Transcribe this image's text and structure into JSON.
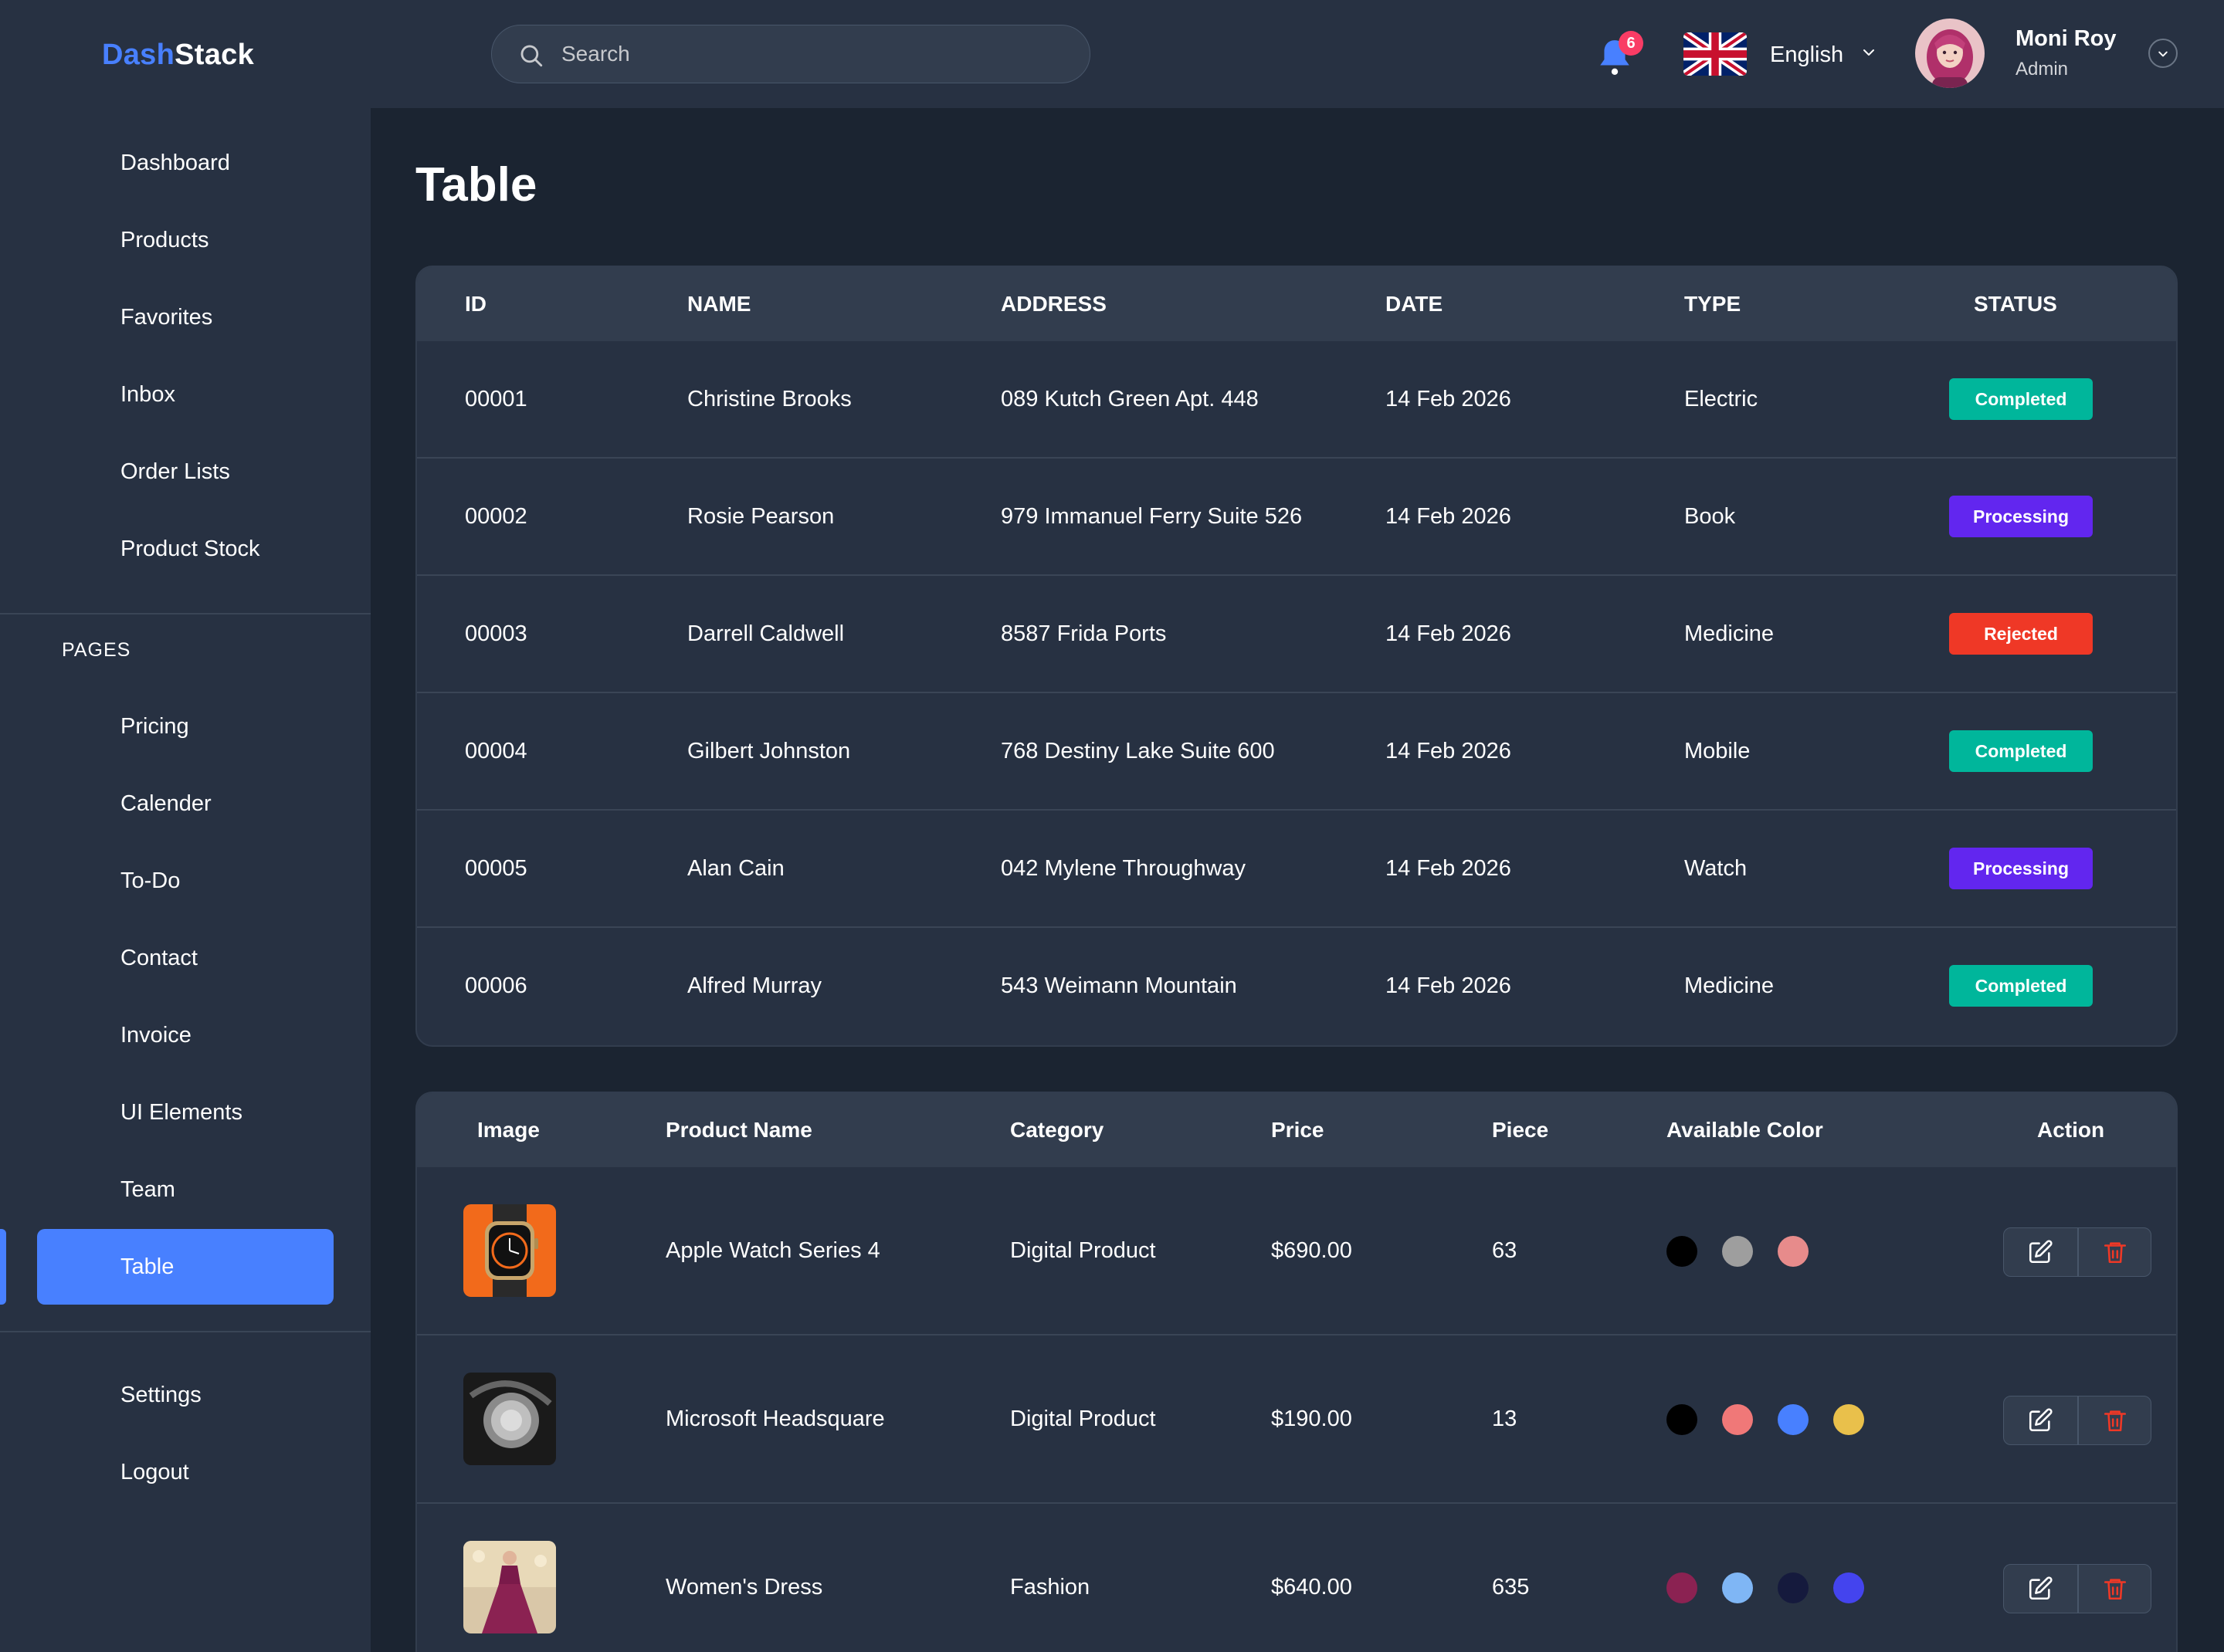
{
  "app": {
    "logo_part1": "Dash",
    "logo_part2": "Stack"
  },
  "header": {
    "search_placeholder": "Search",
    "notification_count": "6",
    "language": "English",
    "user_name": "Moni Roy",
    "user_role": "Admin"
  },
  "sidebar": {
    "main_items": [
      {
        "label": "Dashboard"
      },
      {
        "label": "Products"
      },
      {
        "label": "Favorites"
      },
      {
        "label": "Inbox"
      },
      {
        "label": "Order Lists"
      },
      {
        "label": "Product Stock"
      }
    ],
    "pages_section_label": "PAGES",
    "page_items": [
      {
        "label": "Pricing"
      },
      {
        "label": "Calender"
      },
      {
        "label": "To-Do"
      },
      {
        "label": "Contact"
      },
      {
        "label": "Invoice"
      },
      {
        "label": "UI Elements"
      },
      {
        "label": "Team"
      },
      {
        "label": "Table",
        "active": true
      }
    ],
    "bottom_items": [
      {
        "label": "Settings"
      },
      {
        "label": "Logout"
      }
    ]
  },
  "main": {
    "page_title": "Table",
    "orders_table": {
      "headers": [
        "ID",
        "NAME",
        "ADDRESS",
        "DATE",
        "TYPE",
        "STATUS"
      ],
      "rows": [
        {
          "id": "00001",
          "name": "Christine Brooks",
          "address": "089 Kutch Green Apt. 448",
          "date": "14 Feb 2026",
          "type": "Electric",
          "status": "Completed"
        },
        {
          "id": "00002",
          "name": "Rosie Pearson",
          "address": "979 Immanuel Ferry Suite 526",
          "date": "14 Feb 2026",
          "type": "Book",
          "status": "Processing"
        },
        {
          "id": "00003",
          "name": "Darrell Caldwell",
          "address": "8587 Frida Ports",
          "date": "14 Feb 2026",
          "type": "Medicine",
          "status": "Rejected"
        },
        {
          "id": "00004",
          "name": "Gilbert Johnston",
          "address": "768 Destiny Lake Suite 600",
          "date": "14 Feb 2026",
          "type": "Mobile",
          "status": "Completed"
        },
        {
          "id": "00005",
          "name": "Alan Cain",
          "address": "042 Mylene Throughway",
          "date": "14 Feb 2026",
          "type": "Watch",
          "status": "Processing"
        },
        {
          "id": "00006",
          "name": "Alfred Murray",
          "address": "543 Weimann Mountain",
          "date": "14 Feb 2026",
          "type": "Medicine",
          "status": "Completed"
        }
      ]
    },
    "products_table": {
      "headers": [
        "Image",
        "Product Name",
        "Category",
        "Price",
        "Piece",
        "Available Color",
        "Action"
      ],
      "rows": [
        {
          "product_name": "Apple Watch Series 4",
          "category": "Digital Product",
          "price": "$690.00",
          "piece": "63",
          "colors": [
            "#000000",
            "#9e9e9e",
            "#e78b8b"
          ]
        },
        {
          "product_name": "Microsoft Headsquare",
          "category": "Digital Product",
          "price": "$190.00",
          "piece": "13",
          "colors": [
            "#000000",
            "#f07878",
            "#4880ff",
            "#e9c04b"
          ]
        },
        {
          "product_name": "Women's Dress",
          "category": "Fashion",
          "price": "$640.00",
          "piece": "635",
          "colors": [
            "#8b2252",
            "#7fb6f5",
            "#151a3d",
            "#4444ee"
          ]
        }
      ]
    }
  },
  "colors": {
    "accent": "#4880ff",
    "status_completed": "#00b69b",
    "status_processing": "#6226ef",
    "status_rejected": "#ef3826",
    "delete_red": "#ef3826"
  }
}
